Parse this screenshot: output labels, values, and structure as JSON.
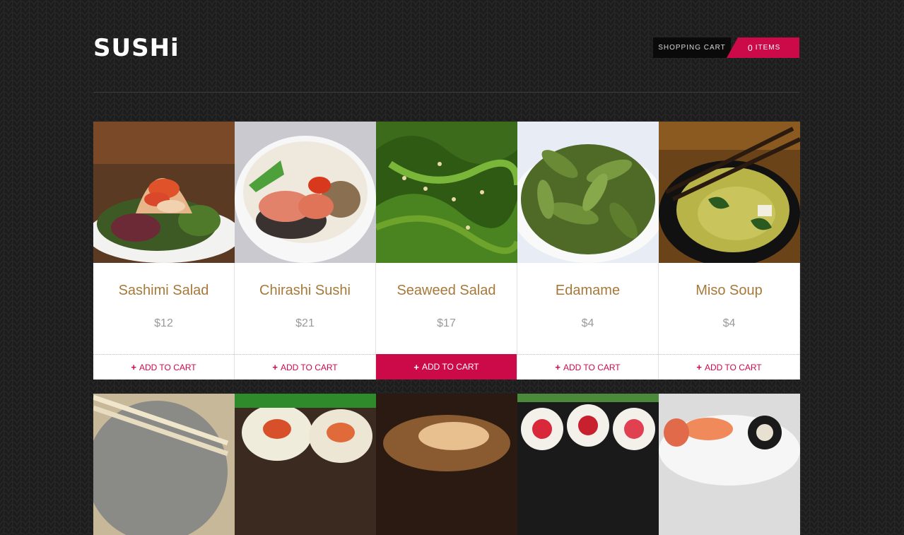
{
  "brand": {
    "logo_text": "SUSHi"
  },
  "cart": {
    "label": "Shopping Cart",
    "count": "0",
    "items_label": "Items"
  },
  "products": [
    {
      "name": "Sashimi Salad",
      "price": "$12",
      "add_label": "Add to Cart",
      "image": "sashimi-salad-photo"
    },
    {
      "name": "Chirashi Sushi",
      "price": "$21",
      "add_label": "Add to Cart",
      "image": "chirashi-sushi-photo"
    },
    {
      "name": "Seaweed Salad",
      "price": "$17",
      "add_label": "Add to Cart",
      "image": "seaweed-salad-photo",
      "hover": true
    },
    {
      "name": "Edamame",
      "price": "$4",
      "add_label": "Add to Cart",
      "image": "edamame-photo"
    },
    {
      "name": "Miso Soup",
      "price": "$4",
      "add_label": "Add to Cart",
      "image": "miso-soup-photo"
    }
  ],
  "colors": {
    "accent": "#cc0a4a",
    "product_name": "#a6793a",
    "price": "#9a9a9a",
    "background": "#1d1d1d"
  },
  "icons": {
    "add": "plus-icon"
  }
}
